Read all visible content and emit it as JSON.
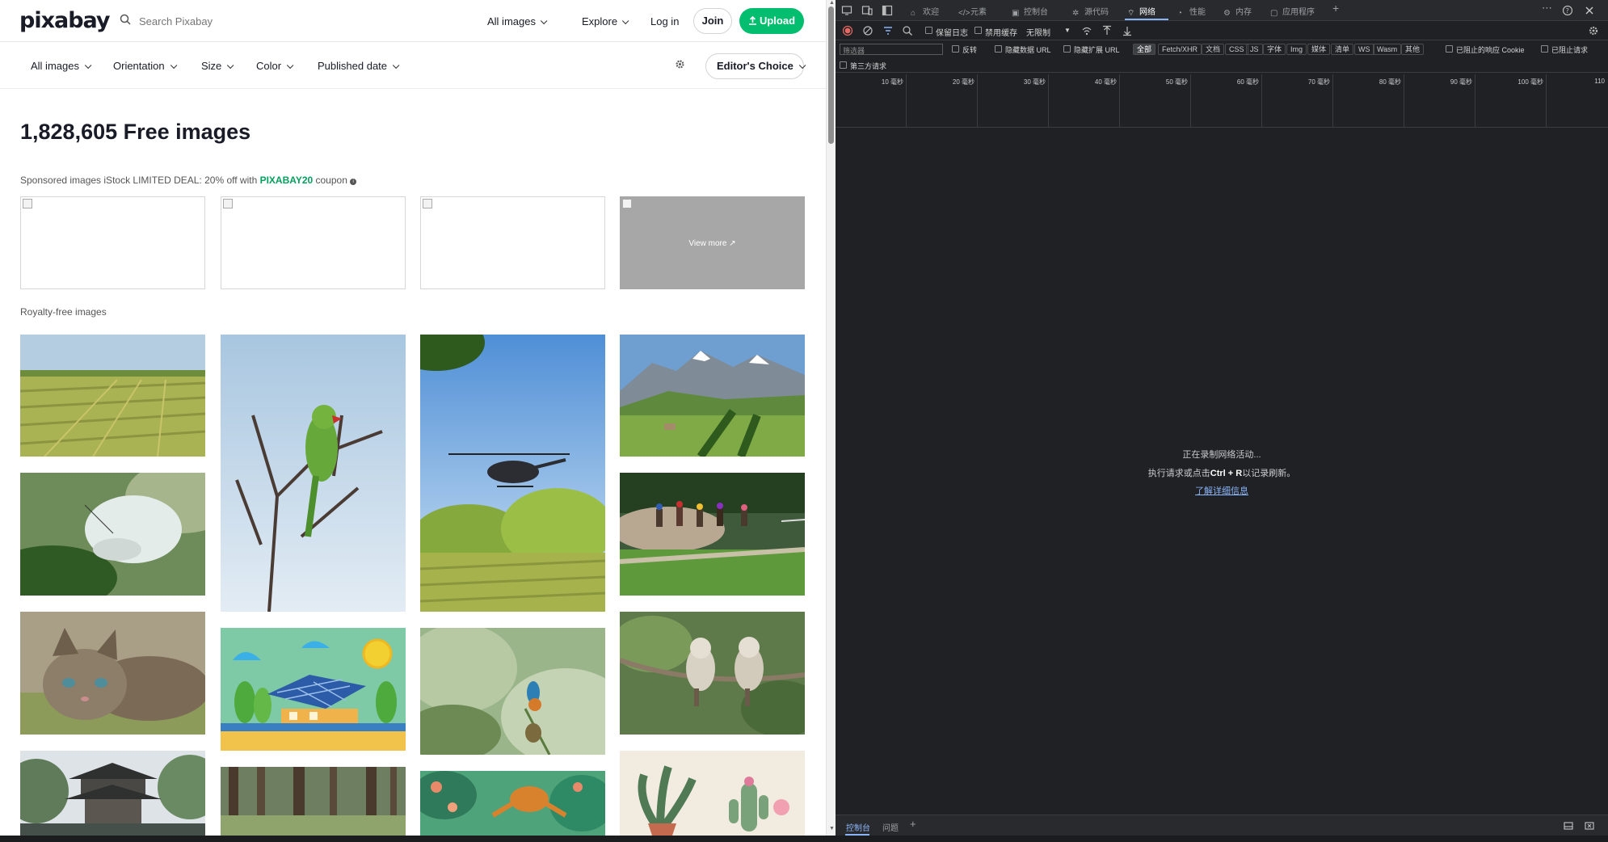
{
  "pixabay": {
    "logo": "pixabay",
    "search_placeholder": "Search Pixabay",
    "nav": {
      "all_images": "All images",
      "explore": "Explore",
      "login": "Log in",
      "join": "Join",
      "upload": "Upload"
    },
    "filters": [
      "All images",
      "Orientation",
      "Size",
      "Color",
      "Published date"
    ],
    "editors_choice": "Editor's Choice",
    "headline": "1,828,605 Free images",
    "sponsored": {
      "prefix": "Sponsored images iStock LIMITED DEAL: 20% off with ",
      "code": "PIXABAY20",
      "suffix": " coupon"
    },
    "view_more": "View more",
    "royalty_label": "Royalty-free images",
    "colors": {
      "brand_green": "#02be6e",
      "code_green": "#02a15d"
    },
    "images": [
      "farm-field",
      "parrot-on-branch",
      "helicopter-over-meadow",
      "mountain-valley",
      "white-butterfly",
      "horse-race",
      "kitten-lying",
      "solar-panel-house-illustration",
      "kingfisher-lotus",
      "kookaburras-on-rope",
      "pagoda-garden",
      "forest-trees",
      "frog-illustration",
      "plants-cactus-illustration"
    ]
  },
  "devtools": {
    "tabs": [
      "欢迎",
      "元素",
      "控制台",
      "源代码",
      "网络",
      "性能",
      "内存",
      "应用程序"
    ],
    "active_tab": "网络",
    "toolbar": {
      "preserve_log": "保留日志",
      "disable_cache": "禁用缓存",
      "throttling": "无限制"
    },
    "filter": {
      "placeholder": "筛选器",
      "invert": "反转",
      "hide_data_urls": "隐藏数据 URL",
      "hide_ext_urls": "隐藏扩展 URL",
      "types": [
        "全部",
        "Fetch/XHR",
        "文档",
        "CSS",
        "JS",
        "字体",
        "Img",
        "媒体",
        "清单",
        "WS",
        "Wasm",
        "其他"
      ],
      "blocked_cookies": "已阻止的响应 Cookie",
      "blocked_requests": "已阻止请求",
      "third_party": "第三方请求"
    },
    "timeline_ticks": [
      "10 毫秒",
      "20 毫秒",
      "30 毫秒",
      "40 毫秒",
      "50 毫秒",
      "60 毫秒",
      "70 毫秒",
      "80 毫秒",
      "90 毫秒",
      "100 毫秒",
      "110"
    ],
    "empty": {
      "line1": "正在录制网络活动...",
      "line2_prefix": "执行请求或点击",
      "line2_key": "Ctrl + R",
      "line2_suffix": "以记录刷新。",
      "learn_more": "了解详细信息"
    },
    "bottom_tabs": [
      "控制台",
      "问题"
    ]
  }
}
